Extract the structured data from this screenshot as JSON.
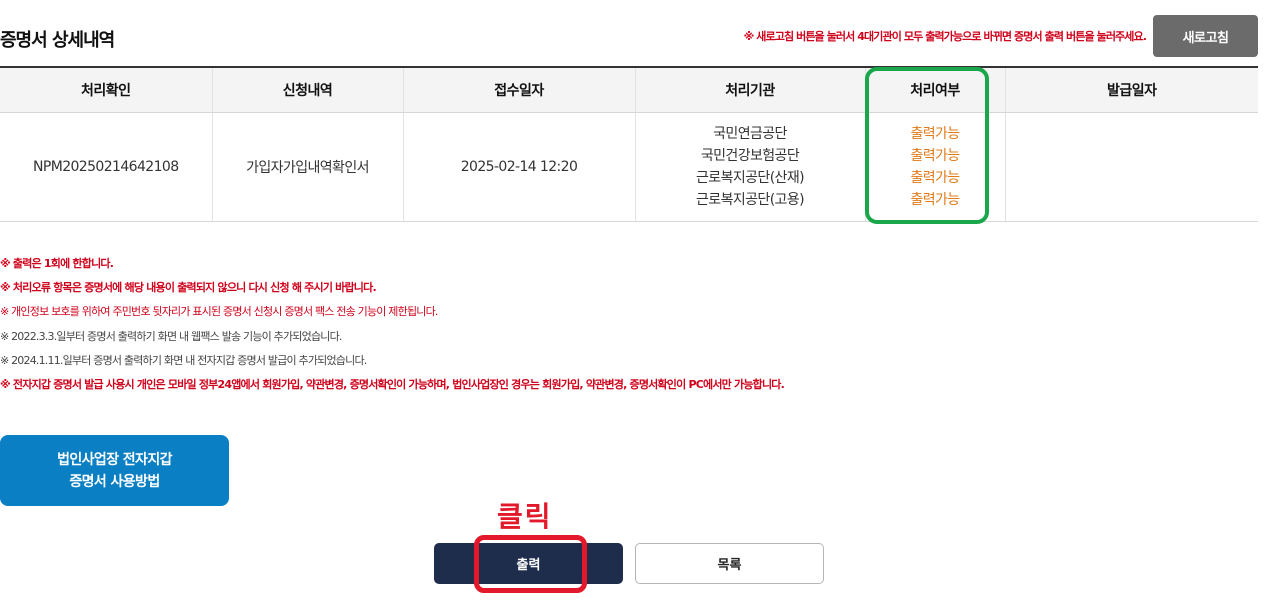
{
  "header": {
    "title": "증명서 상세내역",
    "refresh_notice": "※ 새로고침 버튼을 눌러서 4대기관이 모두 출력가능으로 바뀌면 증명서 출력 버튼을 눌러주세요.",
    "refresh_label": "새로고침"
  },
  "table": {
    "columns": [
      "처리확인",
      "신청내역",
      "접수일자",
      "처리기관",
      "처리여부",
      "발급일자"
    ],
    "row": {
      "confirm_no": "NPM20250214642108",
      "request": "가입자가입내역확인서",
      "received": "2025-02-14 12:20",
      "agencies": [
        "국민연금공단",
        "국민건강보험공단",
        "근로복지공단(산재)",
        "근로복지공단(고용)"
      ],
      "statuses": [
        "출력가능",
        "출력가능",
        "출력가능",
        "출력가능"
      ],
      "issued": ""
    }
  },
  "notes": [
    "※ 출력은 1회에 한합니다.",
    "※ 처리오류 항목은 증명서에 해당 내용이 출력되지 않으니 다시 신청 해 주시기 바랍니다.",
    "※ 개인정보 보호를 위하여 주민번호 뒷자리가 표시된 증명서 신청시 증명서 팩스 전송 기능이 제한됩니다.",
    "※ 2022.3.3.일부터 증명서 출력하기 화면 내 웹팩스 발송 기능이 추가되었습니다.",
    "※ 2024.1.11.일부터 증명서 출력하기 화면 내 전자지갑 증명서 발급이 추가되었습니다.",
    "※ 전자지갑 증명서 발급 사용시 개인은 모바일 정부24앱에서 회원가입, 약관변경, 증명서확인이 가능하며, 법인사업장인 경우는 회원가입, 약관변경, 증명서확인이 PC에서만 가능합니다."
  ],
  "guide_button": {
    "line1": "법인사업장 전자지갑",
    "line2": "증명서 사용방법"
  },
  "annotation": {
    "click_label": "클릭"
  },
  "actions": {
    "print_label": "출력",
    "list_label": "목록"
  },
  "colors": {
    "status_text": "#e07b1a",
    "status_highlight": "#1aa64a",
    "annotation": "#e3192b",
    "print_button": "#1f2d4d",
    "guide_button": "#0a7fc4",
    "notice_red": "#d0021b"
  }
}
